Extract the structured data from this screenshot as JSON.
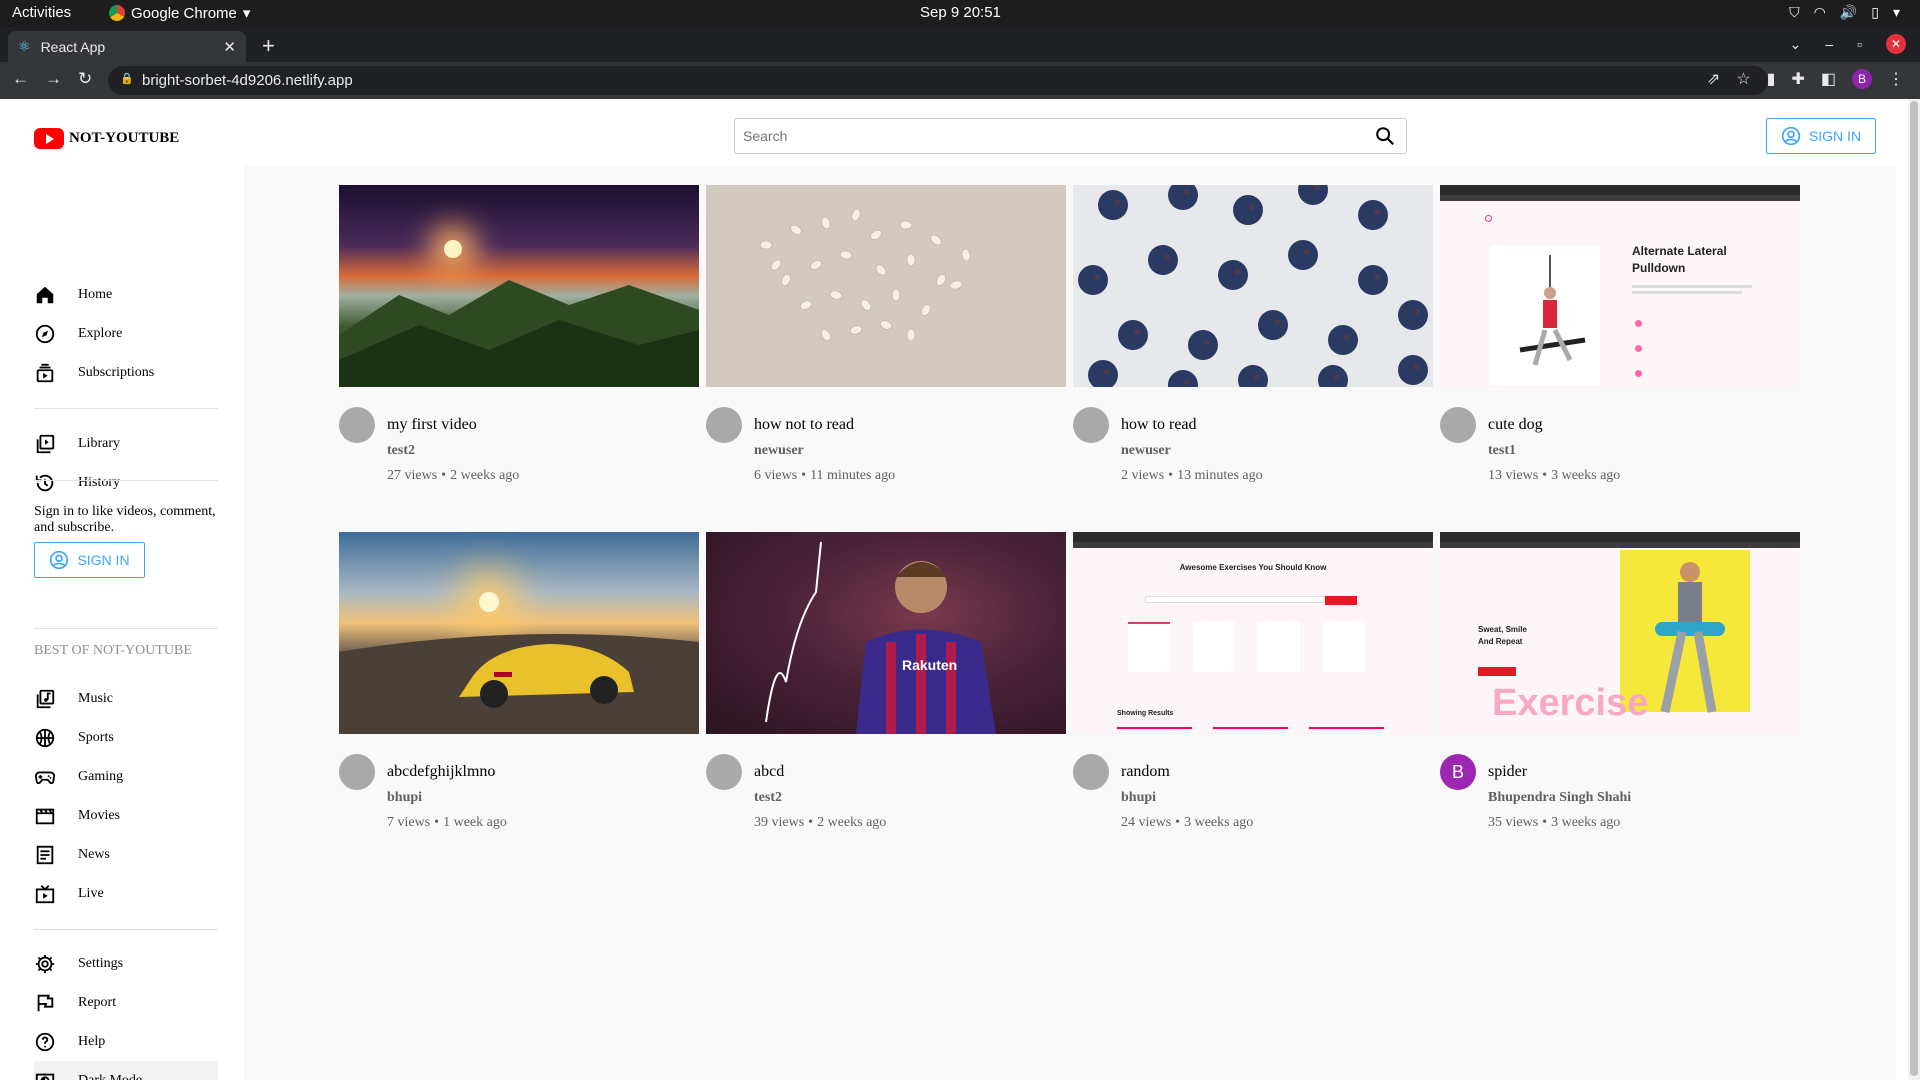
{
  "os": {
    "activities": "Activities",
    "app_name": "Google Chrome",
    "clock": "Sep 9  20:51"
  },
  "browser": {
    "tab_title": "React App",
    "url": "bright-sorbet-4d9206.netlify.app",
    "profile_initial": "B"
  },
  "header": {
    "logo_text": "NOT-YOUTUBE",
    "search_placeholder": "Search",
    "signin_label": "SIGN IN"
  },
  "sidebar": {
    "group1": [
      {
        "label": "Home",
        "icon": "home-icon"
      },
      {
        "label": "Explore",
        "icon": "explore-icon"
      },
      {
        "label": "Subscriptions",
        "icon": "subscriptions-icon"
      }
    ],
    "group2": [
      {
        "label": "Library",
        "icon": "library-icon"
      },
      {
        "label": "History",
        "icon": "history-icon"
      }
    ],
    "signin_prompt": "Sign in to like videos, comment, and subscribe.",
    "signin_label": "SIGN IN",
    "best_of_heading": "BEST OF NOT-YOUTUBE",
    "group3": [
      {
        "label": "Music",
        "icon": "music-icon"
      },
      {
        "label": "Sports",
        "icon": "sports-icon"
      },
      {
        "label": "Gaming",
        "icon": "gaming-icon"
      },
      {
        "label": "Movies",
        "icon": "movies-icon"
      },
      {
        "label": "News",
        "icon": "news-icon"
      },
      {
        "label": "Live",
        "icon": "live-icon"
      }
    ],
    "group4": [
      {
        "label": "Settings",
        "icon": "settings-icon"
      },
      {
        "label": "Report",
        "icon": "report-icon"
      },
      {
        "label": "Help",
        "icon": "help-icon"
      },
      {
        "label": "Dark Mode",
        "icon": "dark-mode-icon"
      }
    ]
  },
  "videos": [
    {
      "title": "my first video",
      "channel": "test2",
      "views": "27 views",
      "age": "2 weeks ago",
      "thumb": "mountain-sunset",
      "avatar": ""
    },
    {
      "title": "how not to read",
      "channel": "newuser",
      "views": "6 views",
      "age": "11 minutes ago",
      "thumb": "seeds",
      "avatar": ""
    },
    {
      "title": "how to read",
      "channel": "newuser",
      "views": "2 views",
      "age": "13 minutes ago",
      "thumb": "blueberries",
      "avatar": ""
    },
    {
      "title": "cute dog",
      "channel": "test1",
      "views": "13 views",
      "age": "3 weeks ago",
      "thumb": "exercise-screenshot",
      "avatar": ""
    },
    {
      "title": "abcdefghijklmno",
      "channel": "bhupi",
      "views": "7 views",
      "age": "1 week ago",
      "thumb": "yellow-car",
      "avatar": ""
    },
    {
      "title": "abcd",
      "channel": "test2",
      "views": "39 views",
      "age": "2 weeks ago",
      "thumb": "football-player",
      "avatar": ""
    },
    {
      "title": "random",
      "channel": "bhupi",
      "views": "24 views",
      "age": "3 weeks ago",
      "thumb": "exercises-site",
      "avatar": ""
    },
    {
      "title": "spider",
      "channel": "Bhupendra Singh Shahi",
      "views": "35 views",
      "age": "3 weeks ago",
      "thumb": "fitness-site",
      "avatar": "B"
    }
  ],
  "thumb_text": {
    "alt_lat_title": "Alternate Lateral Pulldown",
    "awesome_title": "Awesome Exercises You Should Know",
    "showing_results": "Showing Results",
    "fitness_line1": "Sweat, Smile",
    "fitness_line2": "And Repeat",
    "exercise_word": "Exercise",
    "jersey": "Rakuten"
  },
  "colors": {
    "brand_red": "#ff0000",
    "signin_blue": "#3ea6ff",
    "avatar_purple": "#9c27b0"
  }
}
